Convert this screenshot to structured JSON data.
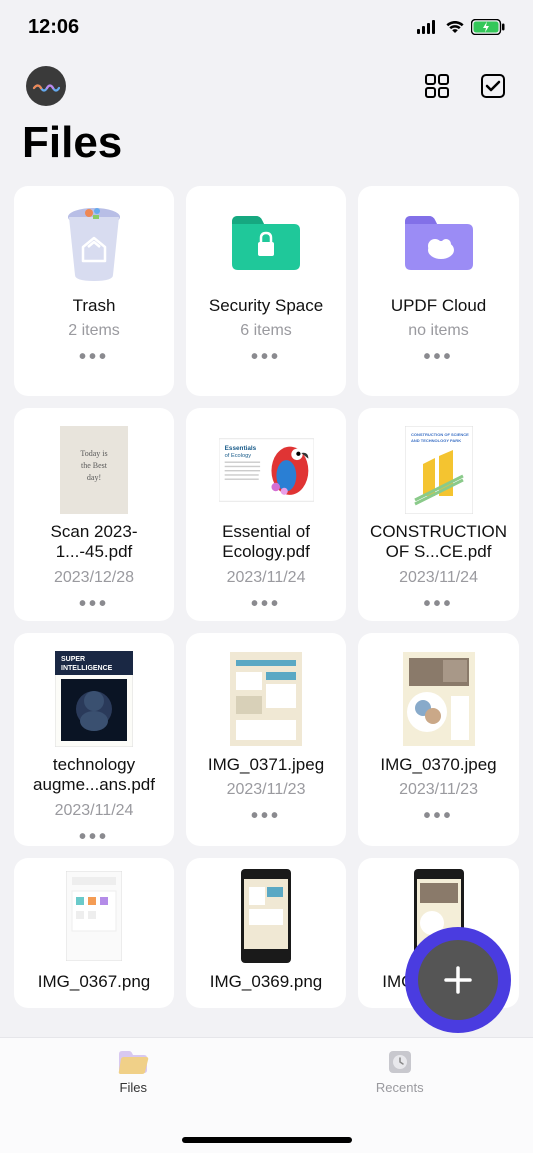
{
  "status": {
    "time": "12:06"
  },
  "header": {
    "title": "Files"
  },
  "cards": [
    {
      "title": "Trash",
      "sub": "2 items",
      "kind": "trash"
    },
    {
      "title": "Security Space",
      "sub": "6 items",
      "kind": "folder-lock"
    },
    {
      "title": "UPDF Cloud",
      "sub": "no items",
      "kind": "folder-cloud"
    },
    {
      "title": "Scan 2023-1...-45.pdf",
      "sub": "2023/12/28",
      "kind": "doc-note"
    },
    {
      "title": "Essential of Ecology.pdf",
      "sub": "2023/11/24",
      "kind": "doc-parrot"
    },
    {
      "title": "CONSTRUCTION OF S...CE.pdf",
      "sub": "2023/11/24",
      "kind": "doc-construction"
    },
    {
      "title": "technology augme...ans.pdf",
      "sub": "2023/11/24",
      "kind": "doc-super"
    },
    {
      "title": "IMG_0371.jpeg",
      "sub": "2023/11/23",
      "kind": "doc-scan1"
    },
    {
      "title": "IMG_0370.jpeg",
      "sub": "2023/11/23",
      "kind": "doc-scan2"
    },
    {
      "title": "IMG_0367.png",
      "sub": "",
      "kind": "doc-ui"
    },
    {
      "title": "IMG_0369.png",
      "sub": "",
      "kind": "doc-phone"
    },
    {
      "title": "IMG_0368.png",
      "sub": "",
      "kind": "doc-phone2"
    }
  ],
  "tabs": {
    "files": "Files",
    "recents": "Recents"
  }
}
